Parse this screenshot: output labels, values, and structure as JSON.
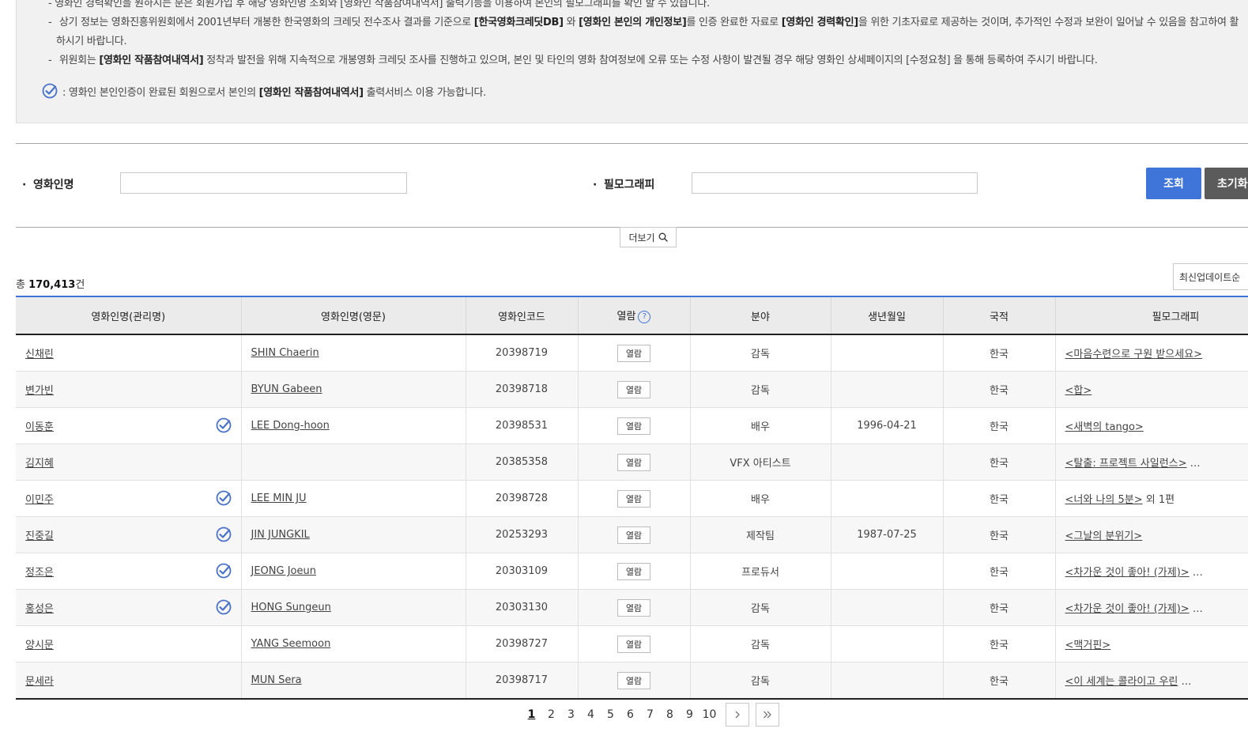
{
  "notice": {
    "line0": "- 영화인 경력확인을 원하시는 분은 회원가입 후 해당 영화인명 조회와 [영화인 작품참여내역서] 출력기능을 이용하여 본인의 필모그래피를 확인 할 수 있습니다.",
    "line1_a": "상기 정보는 영화진흥위원회에서 2001년부터 개봉한 한국영화의 크레딧 전수조사 결과를 기준으로 ",
    "line1_b1": "[한국영화크레딧DB]",
    "line1_c": " 와 ",
    "line1_b2": "[영화인 본인의 개인정보]",
    "line1_d": "를 인증 완료한 자료로 ",
    "line1_b3": "[영화인 경력확인]",
    "line1_e": "을 위한 기초자료로 제공하는 것이며, 추가적인 수정과 보완이 일어날 수 있음을 참고하여 활",
    "line1_cont": "하시기 바랍니다.",
    "line2_a": "위원회는 ",
    "line2_b": "[영화인 작품참여내역서]",
    "line2_c": " 정착과 발전을 위해 지속적으로 개봉영화 크레딧 조사를 진행하고 있으며, 본인 및 타인의 영화 참여정보에 오류 또는 수정 사항이 발견될 경우 해당 영화인 상세페이지의 [수정요청] 을 통해 등록하여 주시기 바랍니다.",
    "check_a": ": 영화인 본인인증이 완료된 회원으로서 본인의 ",
    "check_b": "[영화인 작품참여내역서]",
    "check_c": " 출력서비스 이용 가능합니다."
  },
  "search": {
    "name_label": "영화인명",
    "filmo_label": "필모그래피",
    "name_value": "",
    "filmo_value": "",
    "search_button": "조회",
    "reset_button": "초기화",
    "more_button": "더보기"
  },
  "total": {
    "prefix": "총 ",
    "count": "170,413",
    "suffix": "건"
  },
  "sort": {
    "selected": "최신업데이트순"
  },
  "table": {
    "headers": {
      "name_kr": "영화인명(관리명)",
      "name_en": "영화인명(영문)",
      "code": "영화인코드",
      "view": "열람",
      "field": "분야",
      "birth": "생년월일",
      "nation": "국적",
      "filmo": "필모그래피"
    },
    "view_label": "열람",
    "rows": [
      {
        "name_kr": "신채린",
        "name_en": "SHIN Chaerin",
        "code": "20398719",
        "field": "감독",
        "birth": "",
        "nation": "한국",
        "filmo": "<마음수련으로 구원 받으세요>",
        "filmo_more": "",
        "verified": false
      },
      {
        "name_kr": "변가빈",
        "name_en": "BYUN Gabeen",
        "code": "20398718",
        "field": "감독",
        "birth": "",
        "nation": "한국",
        "filmo": "<합>",
        "filmo_more": "",
        "verified": false
      },
      {
        "name_kr": "이동훈",
        "name_en": "LEE Dong-hoon",
        "code": "20398531",
        "field": "배우",
        "birth": "1996-04-21",
        "nation": "한국",
        "filmo": "<새벽의 tango>",
        "filmo_more": "",
        "verified": true
      },
      {
        "name_kr": "김지혜",
        "name_en": "",
        "code": "20385358",
        "field": "VFX 아티스트",
        "birth": "",
        "nation": "한국",
        "filmo": "<탈출: 프로젝트 사일런스>",
        "filmo_more": " …",
        "verified": false
      },
      {
        "name_kr": "이민주",
        "name_en": "LEE MIN JU",
        "code": "20398728",
        "field": "배우",
        "birth": "",
        "nation": "한국",
        "filmo": "<너와 나의 5분>",
        "filmo_more": " 외 1편",
        "verified": true
      },
      {
        "name_kr": "진중길",
        "name_en": "JIN JUNGKIL",
        "code": "20253293",
        "field": "제작팀",
        "birth": "1987-07-25",
        "nation": "한국",
        "filmo": "<그날의 분위기>",
        "filmo_more": "",
        "verified": true
      },
      {
        "name_kr": "정조은",
        "name_en": "JEONG Joeun",
        "code": "20303109",
        "field": "프로듀서",
        "birth": "",
        "nation": "한국",
        "filmo": "<차가운 것이 좋아! (가제)>",
        "filmo_more": " …",
        "verified": true
      },
      {
        "name_kr": "홍성은",
        "name_en": "HONG Sungeun",
        "code": "20303130",
        "field": "감독",
        "birth": "",
        "nation": "한국",
        "filmo": "<차가운 것이 좋아! (가제)>",
        "filmo_more": " …",
        "verified": true
      },
      {
        "name_kr": "양시문",
        "name_en": "YANG Seemoon",
        "code": "20398727",
        "field": "감독",
        "birth": "",
        "nation": "한국",
        "filmo": "<맥거핀>",
        "filmo_more": "",
        "verified": false
      },
      {
        "name_kr": "문세라",
        "name_en": "MUN Sera",
        "code": "20398717",
        "field": "감독",
        "birth": "",
        "nation": "한국",
        "filmo": "<이 세계는 콜라이고 우린",
        "filmo_more": " …",
        "verified": false
      }
    ]
  },
  "pagination": {
    "pages": [
      "1",
      "2",
      "3",
      "4",
      "5",
      "6",
      "7",
      "8",
      "9",
      "10"
    ],
    "current": "1",
    "next_icon": "chevron-right-icon",
    "last_icon": "double-chevron-right-icon"
  },
  "colors": {
    "accent": "#3f74d8",
    "reset": "#5b5b5b",
    "notice_bg": "#f1f1f1"
  }
}
